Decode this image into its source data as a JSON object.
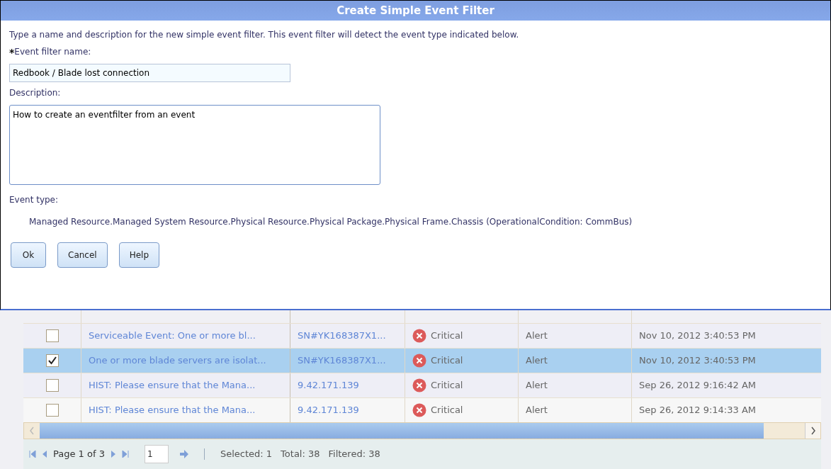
{
  "dialog": {
    "title": "Create Simple Event Filter",
    "intro": "Type a name and description for the new simple event filter. This event filter will detect the event type indicated below.",
    "required_mark": "*",
    "name_label": "Event filter name:",
    "name_value": "Redbook / Blade lost connection",
    "description_label": "Description:",
    "description_value": "How to create an eventfilter from an event",
    "event_type_label": "Event type:",
    "event_type_value": "Managed Resource.Managed System Resource.Physical Resource.Physical Package.Physical Frame.Chassis (OperationalCondition: CommBus)",
    "buttons": [
      "Ok",
      "Cancel",
      "Help"
    ]
  },
  "table": {
    "rows": [
      {
        "checked": false,
        "selected": false,
        "message": "Serviceable Event: One or more bl...",
        "source": "SN#YK168387X1...",
        "severity": "Critical",
        "type": "Alert",
        "date": "Nov 10, 2012 3:40:53 PM"
      },
      {
        "checked": true,
        "selected": true,
        "message": "One or more blade servers are isolat...",
        "source": "SN#YK168387X1...",
        "severity": "Critical",
        "type": "Alert",
        "date": "Nov 10, 2012 3:40:53 PM"
      },
      {
        "checked": false,
        "selected": false,
        "message": "HIST: Please ensure that the Mana...",
        "source": "9.42.171.139",
        "severity": "Critical",
        "type": "Alert",
        "date": "Sep 26, 2012 9:16:42 AM"
      },
      {
        "checked": false,
        "selected": false,
        "message": "HIST: Please ensure that the Mana...",
        "source": "9.42.171.139",
        "severity": "Critical",
        "type": "Alert",
        "date": "Sep 26, 2012 9:14:33 AM"
      }
    ]
  },
  "pager": {
    "page_text": "Page 1 of 3",
    "page_value": "1",
    "selected": "Selected: 1",
    "total": "Total: 38",
    "filtered": "Filtered: 38"
  }
}
